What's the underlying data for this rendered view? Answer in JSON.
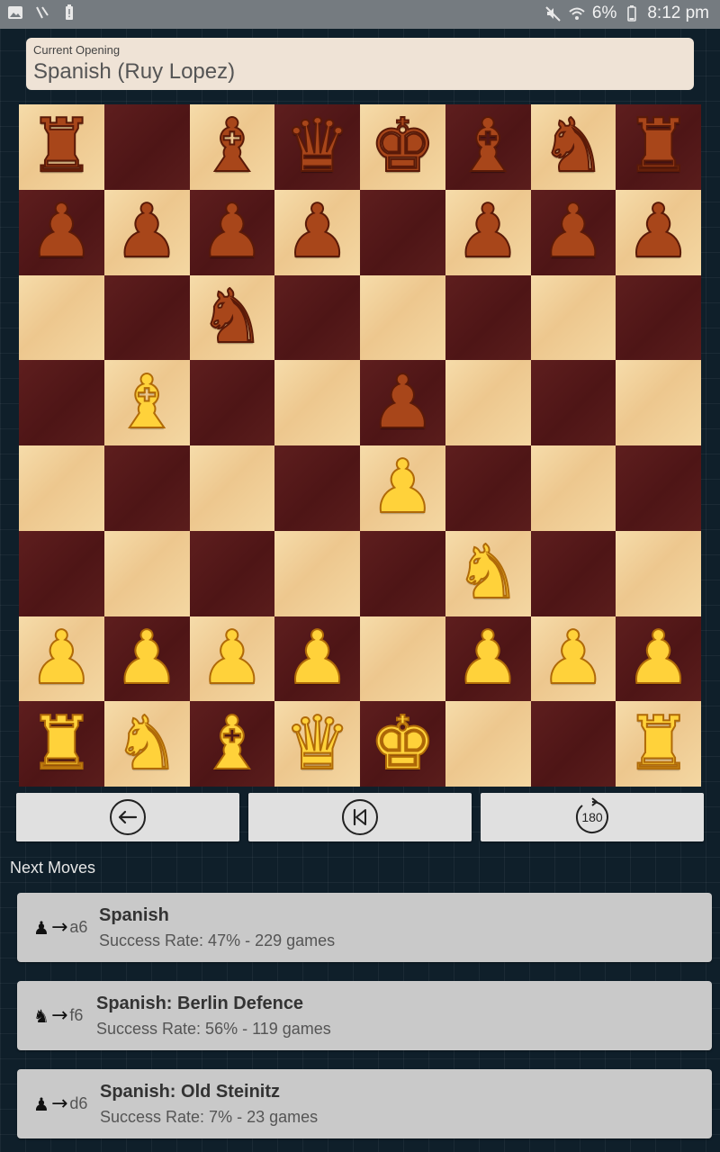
{
  "status_bar": {
    "battery": "6%",
    "time": "8:12 pm"
  },
  "opening": {
    "label": "Current Opening",
    "name": "Spanish (Ruy Lopez)"
  },
  "board": {
    "rows": [
      [
        "r",
        "",
        "b",
        "q",
        "k",
        "b",
        "n",
        "r"
      ],
      [
        "p",
        "p",
        "p",
        "p",
        "",
        "p",
        "p",
        "p"
      ],
      [
        "",
        "",
        "n",
        "",
        "",
        "",
        "",
        ""
      ],
      [
        "",
        "B",
        "",
        "",
        "p",
        "",
        "",
        ""
      ],
      [
        "",
        "",
        "",
        "",
        "P",
        "",
        "",
        ""
      ],
      [
        "",
        "",
        "",
        "",
        "",
        "N",
        "",
        ""
      ],
      [
        "P",
        "P",
        "P",
        "P",
        "",
        "P",
        "P",
        "P"
      ],
      [
        "R",
        "N",
        "B",
        "Q",
        "K",
        "",
        "",
        "R"
      ]
    ]
  },
  "controls": {
    "back_icon": "arrow-left-circle-icon",
    "start_icon": "skip-to-start-icon",
    "rotate_label": "180",
    "rotate_icon": "rotate-180-icon"
  },
  "next_moves": {
    "title": "Next Moves",
    "items": [
      {
        "piece": "pawn",
        "target": "a6",
        "name": "Spanish",
        "stats": "Success Rate: 47% - 229 games"
      },
      {
        "piece": "knight",
        "target": "f6",
        "name": "Spanish: Berlin Defence",
        "stats": "Success Rate: 56% - 119 games"
      },
      {
        "piece": "pawn",
        "target": "d6",
        "name": "Spanish: Old Steinitz",
        "stats": "Success Rate: 7% - 23 games"
      }
    ]
  }
}
